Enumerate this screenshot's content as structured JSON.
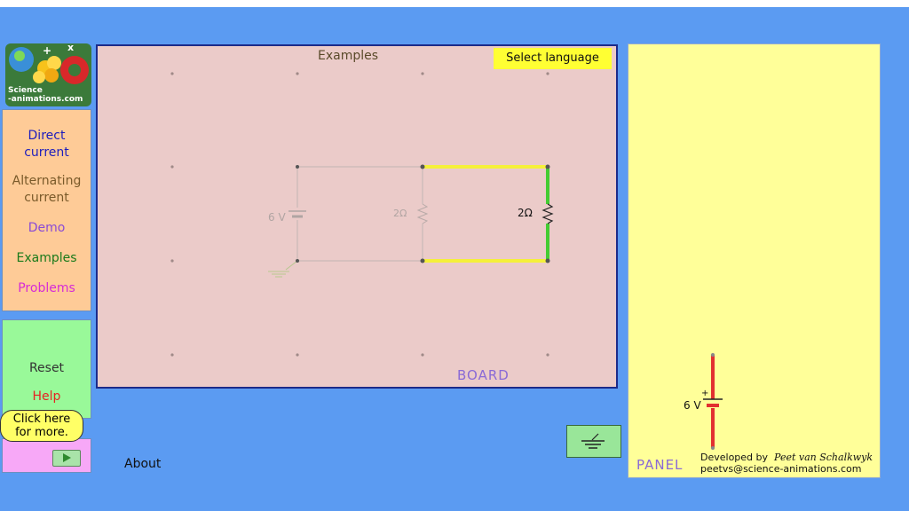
{
  "logo": {
    "line1": "Science",
    "line2": "-animations.com"
  },
  "nav": {
    "direct_current": [
      "Direct",
      "current"
    ],
    "alternating_current": [
      "Alternating",
      "current"
    ],
    "demo": "Demo",
    "examples": "Examples",
    "problems": "Problems"
  },
  "controls": {
    "reset": "Reset",
    "help": "Help"
  },
  "bubble": {
    "line1": "Click here",
    "line2": "for more."
  },
  "about": "About",
  "board": {
    "examples": "Examples",
    "select_language": "Select language",
    "label": "BOARD",
    "battery_label": "6 V",
    "resistor_faded_label": "2Ω",
    "resistor_active_label": "2Ω"
  },
  "panel": {
    "label": "PANEL",
    "battery_label": "6 V",
    "plus": "+",
    "developed_by": "Developed by",
    "author": "Peet van Schalkwyk",
    "email": "peetvs@science-animations.com"
  },
  "colors": {
    "background": "#5b9bf2",
    "board": "#ebcbc9",
    "panel": "#ffff99",
    "nav": "#fecb97",
    "controls": "#99f999",
    "wire_yellow": "#f5f03a",
    "resistor_green": "#44cc33",
    "battery_red": "#e23030"
  }
}
